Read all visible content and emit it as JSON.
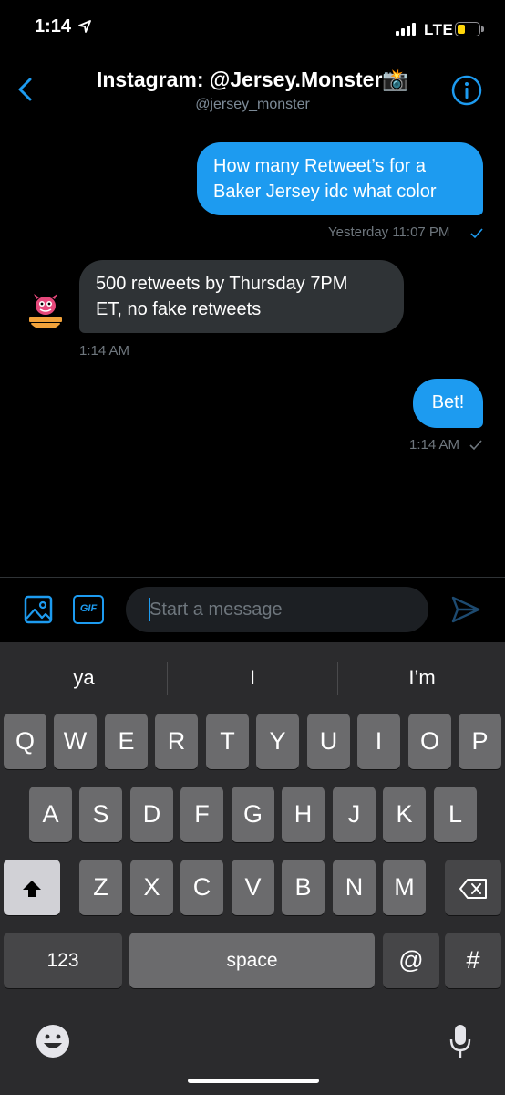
{
  "status_bar": {
    "time": "1:14",
    "carrier": "LTE"
  },
  "header": {
    "title": "Instagram: @Jersey.Monster📸",
    "handle": "@jersey_monster"
  },
  "messages": [
    {
      "direction": "outgoing",
      "text_line1": "How many Retweet’s for a",
      "text_line2": "Baker Jersey idc what color",
      "timestamp": "Yesterday 11:07 PM"
    },
    {
      "direction": "incoming",
      "text_line1": "500 retweets by Thursday 7PM",
      "text_line2": "ET, no fake retweets",
      "timestamp": "1:14 AM"
    },
    {
      "direction": "outgoing",
      "text": "Bet!",
      "timestamp": "1:14 AM"
    }
  ],
  "composer": {
    "gif_label": "GIF",
    "placeholder": "Start a message"
  },
  "keyboard": {
    "suggestions": [
      "ya",
      "I",
      "I’m"
    ],
    "row1": [
      "Q",
      "W",
      "E",
      "R",
      "T",
      "Y",
      "U",
      "I",
      "O",
      "P"
    ],
    "row2": [
      "A",
      "S",
      "D",
      "F",
      "G",
      "H",
      "J",
      "K",
      "L"
    ],
    "row3": [
      "Z",
      "X",
      "C",
      "V",
      "B",
      "N",
      "M"
    ],
    "numbers_label": "123",
    "space_label": "space",
    "at_label": "@",
    "hash_label": "#"
  },
  "colors": {
    "accent": "#1d9bf0",
    "incoming_bubble": "#2f3336",
    "keyboard_bg": "#2b2b2d"
  }
}
